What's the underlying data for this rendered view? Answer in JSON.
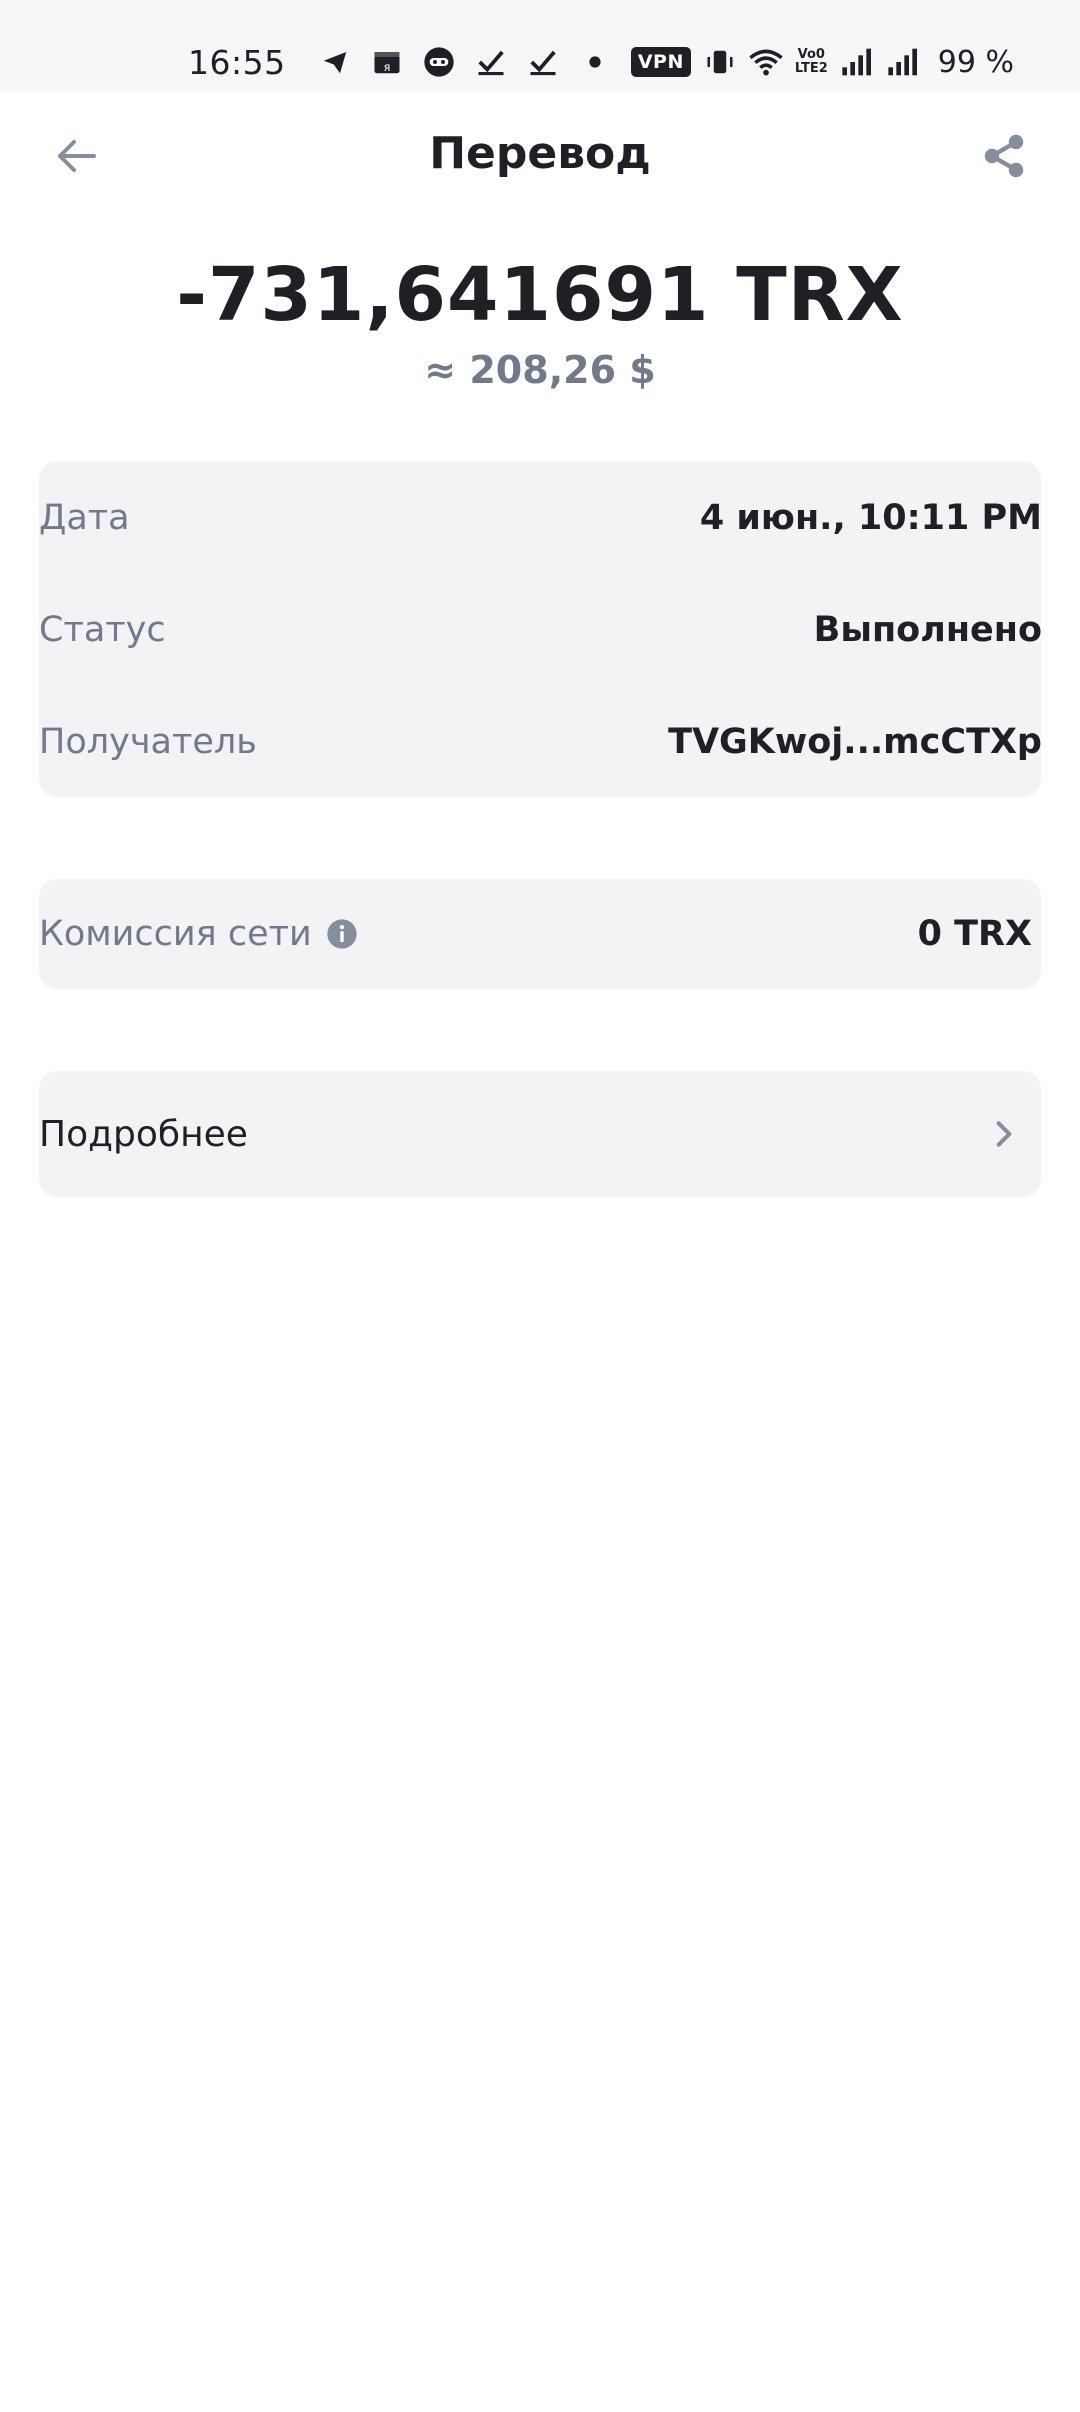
{
  "status_bar": {
    "time": "16:55",
    "left_icons": [
      "telegram-icon",
      "yandex-icon",
      "game-controller-icon",
      "checkmark-icon",
      "checkmark-icon",
      "dot-icon"
    ],
    "vpn": "VPN",
    "lte_top": "Vo0",
    "lte_bottom": "LTE2",
    "battery": "99 %"
  },
  "header": {
    "title": "Перевод"
  },
  "transaction": {
    "amount": "-731,641691 TRX",
    "fiat": "≈ 208,26 $"
  },
  "details": {
    "date_label": "Дата",
    "date_value": "4 июн., 10:11 PM",
    "status_label": "Статус",
    "status_value": "Выполнено",
    "recipient_label": "Получатель",
    "recipient_value": "TVGKwoj...mcCTXp"
  },
  "fee": {
    "label": "Комиссия сети",
    "value": "0 TRX"
  },
  "more": {
    "label": "Подробнее"
  },
  "colors": {
    "text_primary": "#1e2026",
    "text_secondary": "#707a8a",
    "card_bg": "#f3f3f5",
    "icon_gray": "#848e9c"
  }
}
